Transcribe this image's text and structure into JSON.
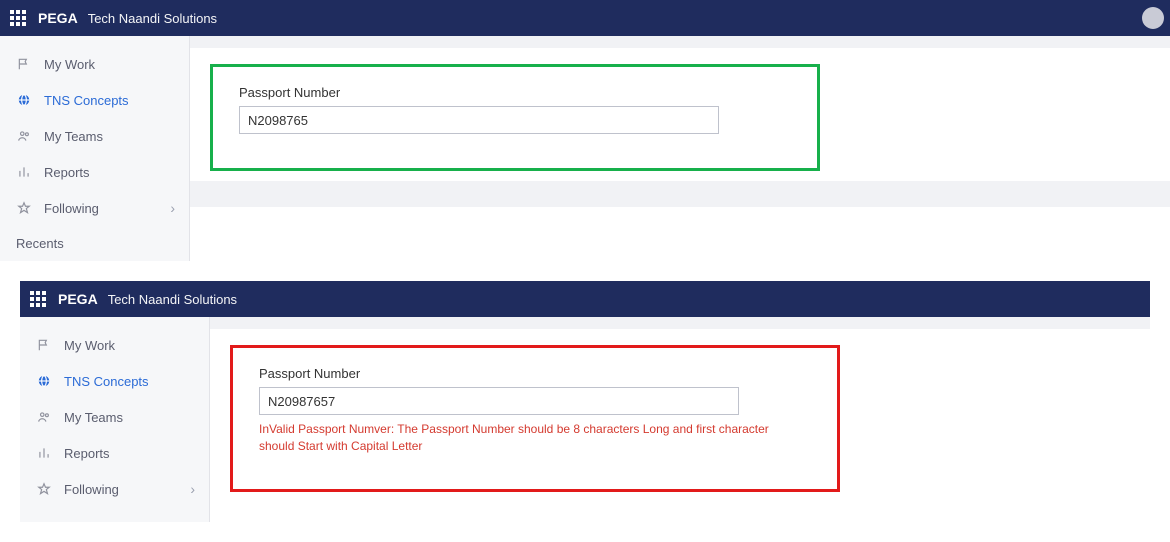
{
  "shot1": {
    "header": {
      "brand": "PEGA",
      "app": "Tech Naandi Solutions"
    },
    "sidebar": {
      "items": [
        {
          "label": "My Work"
        },
        {
          "label": "TNS Concepts"
        },
        {
          "label": "My Teams"
        },
        {
          "label": "Reports"
        },
        {
          "label": "Following"
        }
      ],
      "recents_label": "Recents"
    },
    "form": {
      "passport_label": "Passport Number",
      "passport_value": "N2098765"
    }
  },
  "shot2": {
    "header": {
      "brand": "PEGA",
      "app": "Tech Naandi Solutions"
    },
    "sidebar": {
      "items": [
        {
          "label": "My Work"
        },
        {
          "label": "TNS Concepts"
        },
        {
          "label": "My Teams"
        },
        {
          "label": "Reports"
        },
        {
          "label": "Following"
        }
      ]
    },
    "form": {
      "passport_label": "Passport Number",
      "passport_value": "N20987657",
      "error": "InValid Passport Numver: The Passport Number should be 8 characters Long and first character should Start with Capital Letter"
    }
  }
}
